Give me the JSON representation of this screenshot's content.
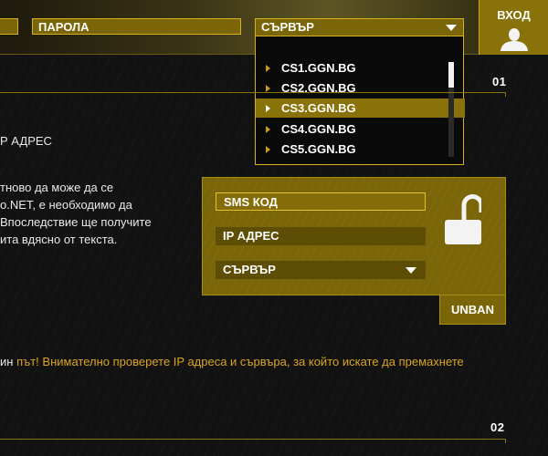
{
  "header": {
    "password_label": "ПАРОЛА",
    "server_label": "СЪРВЪР",
    "login_label": "ВХОД",
    "servers": [
      "CS1.GGN.BG",
      "CS2.GGN.BG",
      "CS3.GGN.BG",
      "CS4.GGN.BG",
      "CS5.GGN.BG"
    ],
    "selected_server": "CS3.GGN.BG"
  },
  "section1": {
    "number": "01",
    "heading_fragment": "Р АДРЕС",
    "paragraph_lines": [
      "тново да може да се",
      "о.NET, е необходимо да",
      "Впоследствие ще получите",
      "ита вдясно от текста."
    ],
    "notice_prefix": "ин ",
    "notice_highlight": "път! Внимателно проверете IP адреса и сървъра, за който искате да премахнете"
  },
  "sms_form": {
    "sms_code_label": "SMS КОД",
    "ip_label": "IP АДРЕС",
    "server_label": "СЪРВЪР",
    "unban_label": "UNBAN"
  },
  "section2": {
    "number": "02"
  },
  "colors": {
    "accent": "#8a720a",
    "accent_border": "#d4b21c",
    "highlight_text": "#d9a521"
  }
}
